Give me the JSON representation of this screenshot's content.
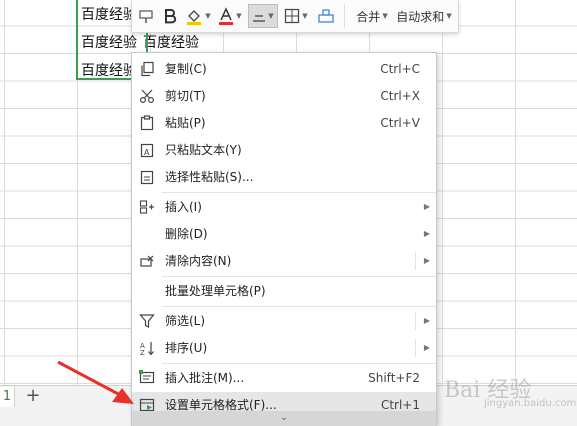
{
  "cells": {
    "row1_col1": "百度经验",
    "row2_col1": "百度经验",
    "row2_col2": "百度经验",
    "row3_col1": "百度经验"
  },
  "sheet_bar": {
    "tab_number": "1",
    "add_sheet": "+"
  },
  "mini_toolbar": {
    "merge_label": "合并",
    "autosum_label": "自动求和"
  },
  "context_menu": {
    "items": [
      {
        "icon": "copy-icon",
        "label": "复制(C)",
        "shortcut": "Ctrl+C"
      },
      {
        "icon": "cut-icon",
        "label": "剪切(T)",
        "shortcut": "Ctrl+X"
      },
      {
        "icon": "paste-icon",
        "label": "粘贴(P)",
        "shortcut": "Ctrl+V"
      },
      {
        "icon": "paste-text-icon",
        "label": "只粘贴文本(Y)",
        "shortcut": ""
      },
      {
        "icon": "paste-special-icon",
        "label": "选择性粘贴(S)...",
        "shortcut": ""
      },
      {
        "icon": "insert-icon",
        "label": "插入(I)",
        "shortcut": ""
      },
      {
        "icon": "",
        "label": "删除(D)",
        "shortcut": ""
      },
      {
        "icon": "clear-icon",
        "label": "清除内容(N)",
        "shortcut": ""
      },
      {
        "icon": "",
        "label": "批量处理单元格(P)",
        "shortcut": ""
      },
      {
        "icon": "filter-icon",
        "label": "筛选(L)",
        "shortcut": ""
      },
      {
        "icon": "sort-icon",
        "label": "排序(U)",
        "shortcut": ""
      },
      {
        "icon": "comment-icon",
        "label": "插入批注(M)...",
        "shortcut": "Shift+F2"
      },
      {
        "icon": "format-cells-icon",
        "label": "设置单元格格式(F)...",
        "shortcut": "Ctrl+1"
      }
    ],
    "more_indicator": "⌄"
  },
  "watermark": {
    "logo_text": "Bai 经验",
    "url_text": "jingyan.baidu.com"
  },
  "colors": {
    "selection_green": "#3c9d4e",
    "font_color_red": "#e03030",
    "fill_yellow": "#f2c400",
    "arrow_red": "#e8312a"
  }
}
